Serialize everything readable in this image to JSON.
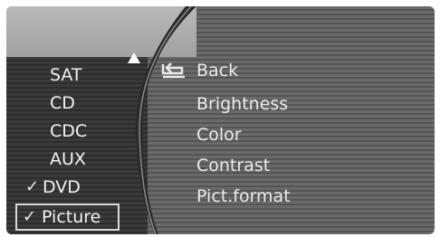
{
  "colors": {
    "accent": "#ffffff",
    "panel_dark": "#2f2f2f",
    "panel_mid": "#5f5f5f",
    "topbar": "#afafaf"
  },
  "sources": {
    "items": [
      {
        "label": "SAT",
        "checked": false
      },
      {
        "label": "CD",
        "checked": false
      },
      {
        "label": "CDC",
        "checked": false
      },
      {
        "label": "AUX",
        "checked": false
      },
      {
        "label": "DVD",
        "checked": true,
        "check": "✓"
      },
      {
        "label": "Picture",
        "checked": true,
        "check": "✓",
        "selected": true
      }
    ]
  },
  "settings_menu": {
    "back": {
      "label": "Back",
      "icon": "back-arrow-icon"
    },
    "items": [
      "Brightness",
      "Color",
      "Contrast",
      "Pict.format"
    ]
  }
}
